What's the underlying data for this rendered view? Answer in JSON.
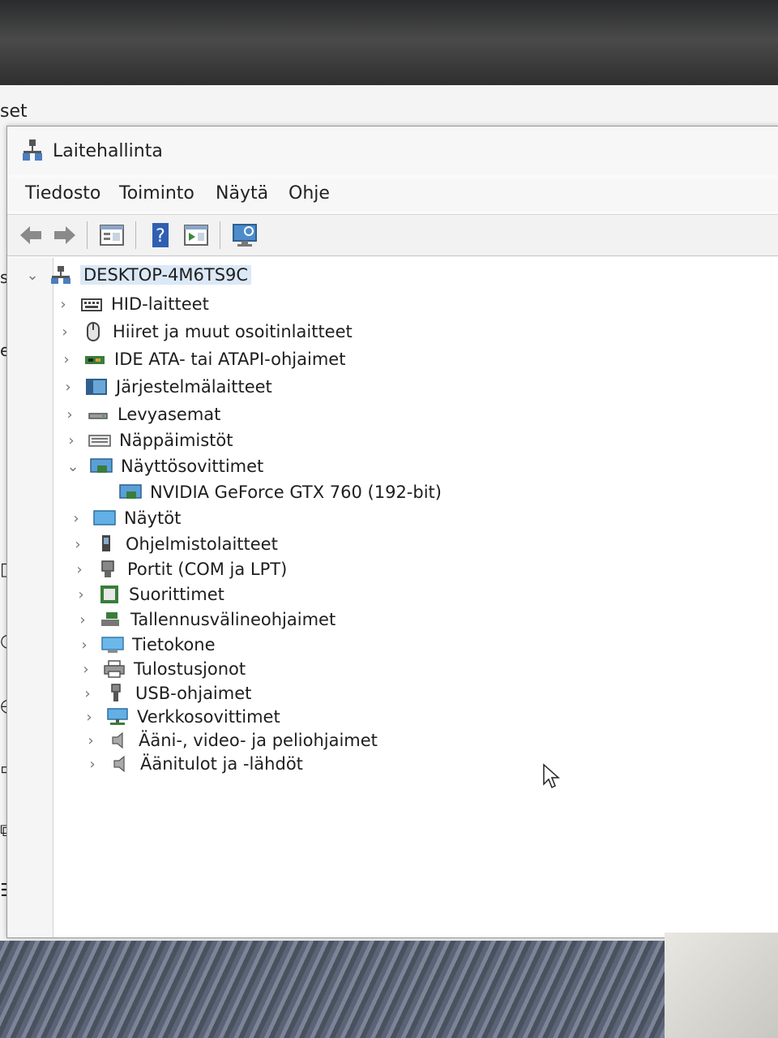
{
  "background_window": {
    "title_fragment": "set",
    "side_fragments": [
      "si",
      "es"
    ]
  },
  "device_manager": {
    "title": "Laitehallinta",
    "menu": [
      "Tiedosto",
      "Toiminto",
      "Näytä",
      "Ohje"
    ],
    "toolbar_icons": [
      "back-arrow-icon",
      "forward-arrow-icon",
      "properties-icon",
      "help-icon",
      "update-driver-icon",
      "scan-hardware-icon"
    ],
    "tree": {
      "root": "DESKTOP-4M6TS9C",
      "categories": [
        {
          "label": "HID-laitteet",
          "icon": "hid-icon",
          "expanded": false
        },
        {
          "label": "Hiiret ja muut osoitinlaitteet",
          "icon": "mouse-icon",
          "expanded": false
        },
        {
          "label": "IDE ATA- tai ATAPI-ohjaimet",
          "icon": "ide-controller-icon",
          "expanded": false
        },
        {
          "label": "Järjestelmälaitteet",
          "icon": "system-device-icon",
          "expanded": false
        },
        {
          "label": "Levyasemat",
          "icon": "disk-drive-icon",
          "expanded": false
        },
        {
          "label": "Näppäimistöt",
          "icon": "keyboard-icon",
          "expanded": false
        },
        {
          "label": "Näyttösovittimet",
          "icon": "display-adapter-icon",
          "expanded": true,
          "children": [
            {
              "label": "NVIDIA GeForce GTX 760 (192-bit)",
              "icon": "display-adapter-icon"
            }
          ]
        },
        {
          "label": "Näytöt",
          "icon": "monitor-icon",
          "expanded": false
        },
        {
          "label": "Ohjelmistolaitteet",
          "icon": "software-device-icon",
          "expanded": false
        },
        {
          "label": "Portit (COM ja LPT)",
          "icon": "port-icon",
          "expanded": false
        },
        {
          "label": "Suorittimet",
          "icon": "processor-icon",
          "expanded": false
        },
        {
          "label": "Tallennusvälineohjaimet",
          "icon": "storage-controller-icon",
          "expanded": false
        },
        {
          "label": "Tietokone",
          "icon": "computer-icon",
          "expanded": false
        },
        {
          "label": "Tulostusjonot",
          "icon": "print-queue-icon",
          "expanded": false
        },
        {
          "label": "USB-ohjaimet",
          "icon": "usb-icon",
          "expanded": false
        },
        {
          "label": "Verkkosovittimet",
          "icon": "network-adapter-icon",
          "expanded": false
        },
        {
          "label": "Ääni-, video- ja peliohjaimet",
          "icon": "sound-icon",
          "expanded": false
        },
        {
          "label": "Äänitulot ja -lähdöt",
          "icon": "audio-io-icon",
          "expanded": false
        }
      ]
    }
  }
}
